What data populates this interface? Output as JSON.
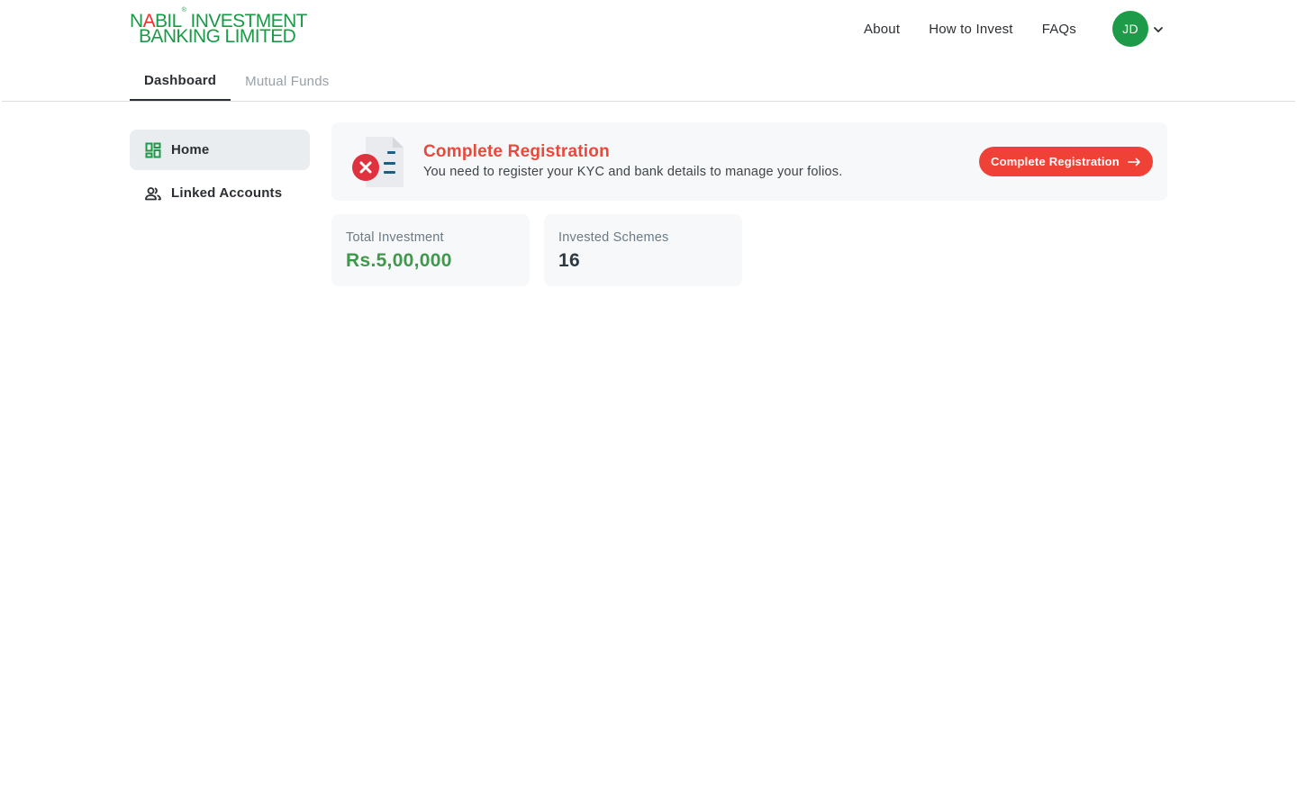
{
  "brand": {
    "line1_pre": "N",
    "line1_red": "A",
    "line1_post": "BIL",
    "registered_mark": "®",
    "line1_tail": " INVESTMENT",
    "line2": "BANKING LIMITED",
    "primary_color": "#1a9a47",
    "accent_color": "#e8312f"
  },
  "topnav": {
    "items": [
      {
        "label": "About"
      },
      {
        "label": "How to Invest"
      },
      {
        "label": "FAQs"
      }
    ],
    "avatar_initials": "JD",
    "avatar_color": "#1d9b48",
    "avatar_menu_icon": "chevron-down-icon"
  },
  "tabs": [
    {
      "label": "Dashboard",
      "active": true
    },
    {
      "label": "Mutual Funds",
      "active": false
    }
  ],
  "sidebar": {
    "items": [
      {
        "label": "Home",
        "icon": "dashboard-grid-icon",
        "active": true
      },
      {
        "label": "Linked Accounts",
        "icon": "people-icon",
        "active": false
      }
    ]
  },
  "registration": {
    "icon": "document-error-icon",
    "title": "Complete Registration",
    "subtitle": "You need to register your KYC and bank details to manage your folios.",
    "button_label": "Complete Registration",
    "button_icon": "arrow-right-icon",
    "button_color": "#ef4136"
  },
  "stats": [
    {
      "label": "Total Investment",
      "value": "Rs.5,00,000",
      "value_color": "#3d9a4a"
    },
    {
      "label": "Invested Schemes",
      "value": "16",
      "value_color": "#2b3a44"
    }
  ]
}
